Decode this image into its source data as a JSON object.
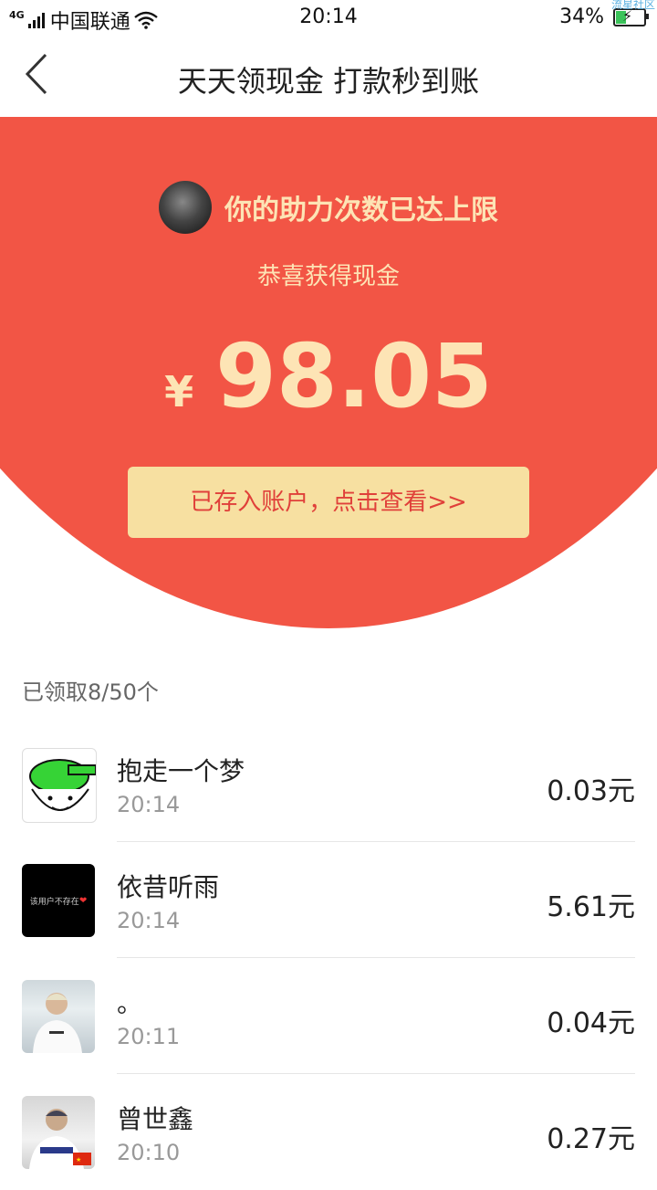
{
  "status_bar": {
    "network": "4G",
    "carrier": "中国联通",
    "time": "20:14",
    "battery": "34%",
    "watermark": "流星社区"
  },
  "nav": {
    "title": "天天领现金 打款秒到账"
  },
  "hero": {
    "limit_text": "你的助力次数已达上限",
    "congrats": "恭喜获得现金",
    "currency": "¥",
    "amount": "98.05",
    "deposit_button": "已存入账户，点击查看>>"
  },
  "claimed": {
    "label": "已领取8/50个"
  },
  "list": [
    {
      "name": "抱走一个梦",
      "time": "20:14",
      "value": "0.03元"
    },
    {
      "name": "依昔听雨",
      "time": "20:14",
      "value": "5.61元",
      "avatar_text": "该用户不存在"
    },
    {
      "name": "。",
      "time": "20:11",
      "value": "0.04元"
    },
    {
      "name": "曾世鑫",
      "time": "20:10",
      "value": "0.27元"
    }
  ],
  "colors": {
    "hero_red": "#f25545",
    "gold_text": "#fde4b5",
    "button_bg": "#f7e0a1",
    "button_text": "#e0403a"
  }
}
